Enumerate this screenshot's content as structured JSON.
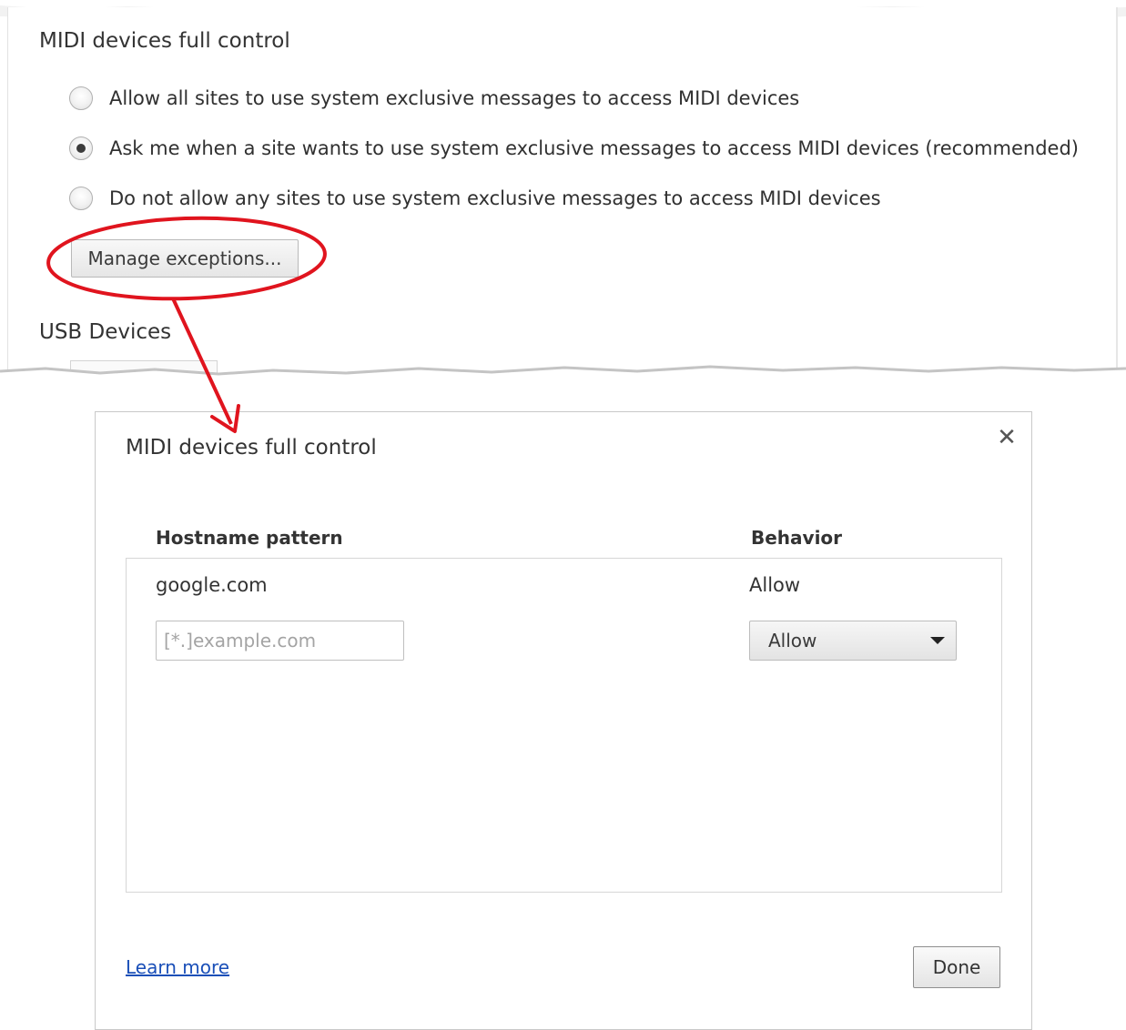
{
  "settings": {
    "section_title": "MIDI devices full control",
    "radio_options": [
      {
        "label": "Allow all sites to use system exclusive messages to access MIDI devices",
        "checked": false
      },
      {
        "label": "Ask me when a site wants to use system exclusive messages to access MIDI devices (recommended)",
        "checked": true
      },
      {
        "label": "Do not allow any sites to use system exclusive messages to access MIDI devices",
        "checked": false
      }
    ],
    "manage_button_label": "Manage exceptions...",
    "next_section_title": "USB Devices"
  },
  "dialog": {
    "title": "MIDI devices full control",
    "close_icon": "close-icon",
    "columns": {
      "hostname": "Hostname pattern",
      "behavior": "Behavior"
    },
    "rows": [
      {
        "hostname": "google.com",
        "behavior": "Allow"
      }
    ],
    "new_entry": {
      "placeholder": "[*.]example.com",
      "value": "",
      "behavior": "Allow"
    },
    "learn_more_label": "Learn more",
    "done_label": "Done"
  },
  "colors": {
    "annotation": "#e0141e",
    "link": "#1a4fb8"
  }
}
